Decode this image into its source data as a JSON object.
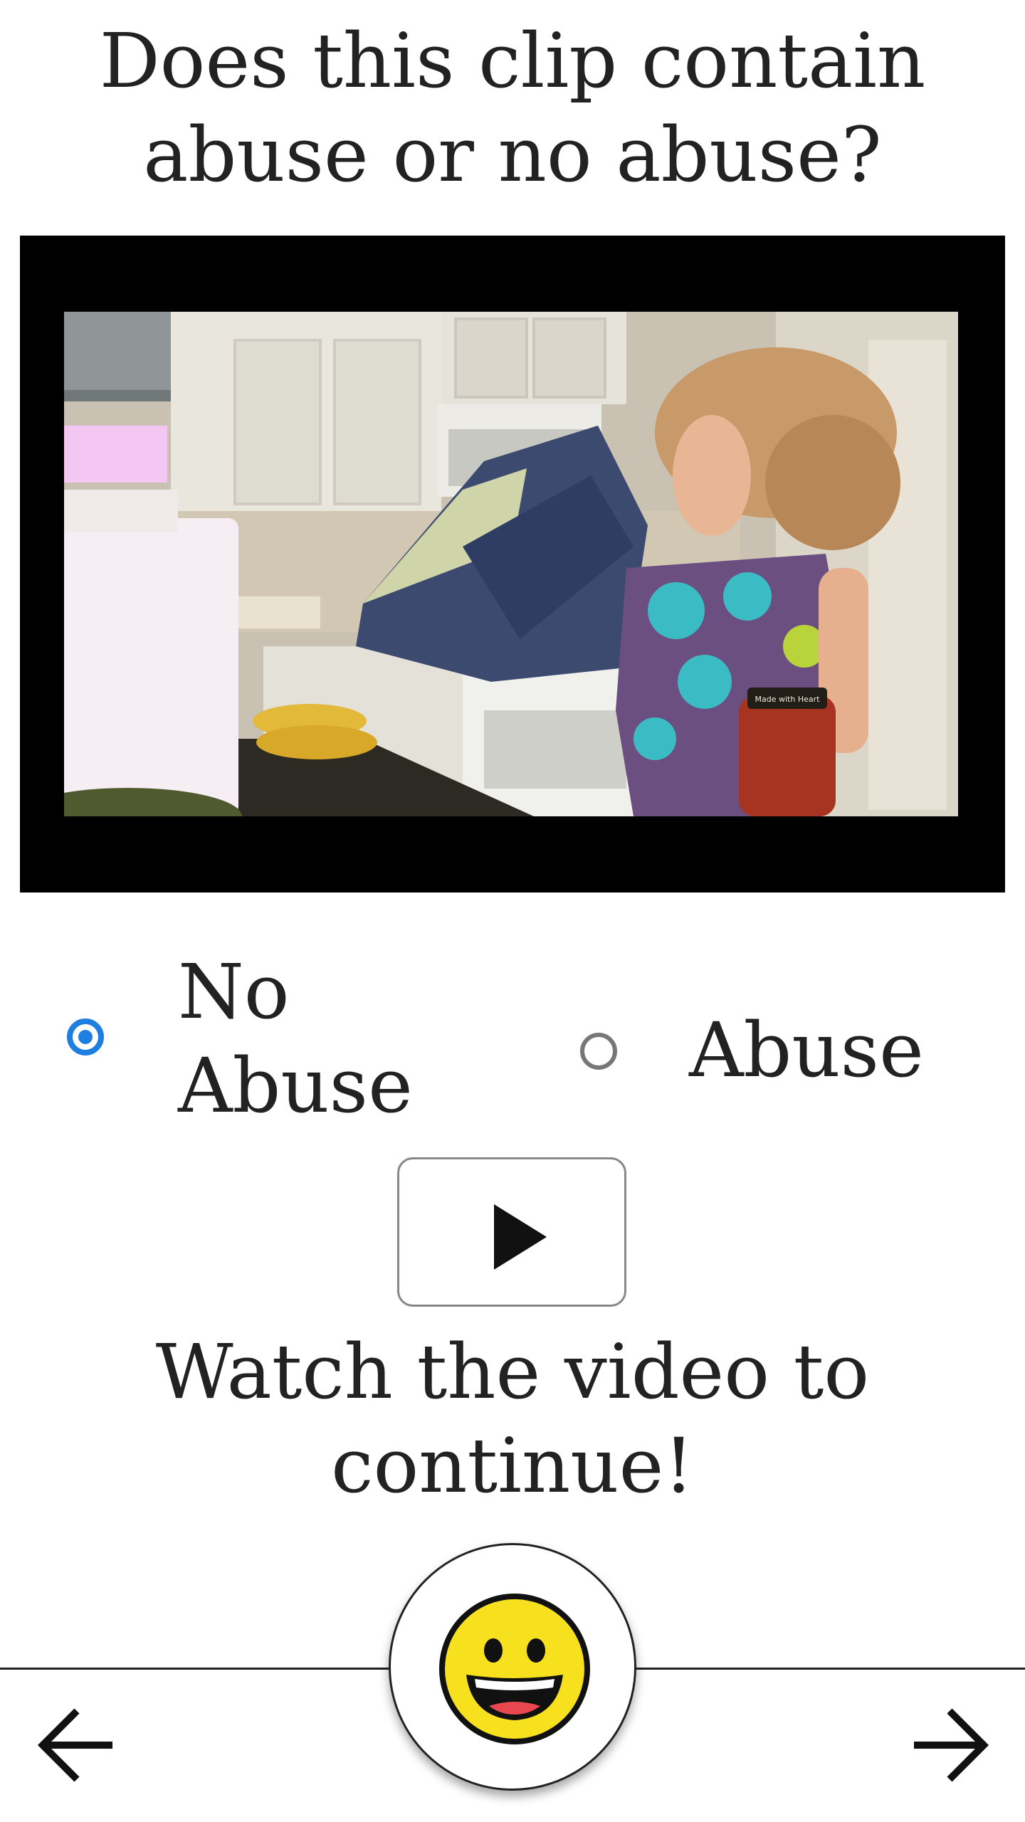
{
  "question": {
    "line1": "Does this clip contain",
    "line2": "abuse or no abuse?"
  },
  "video": {
    "jar_label": "Made with Heart"
  },
  "options": [
    {
      "line1": "No",
      "line2": "Abuse",
      "selected": true
    },
    {
      "line1": "Abuse",
      "selected": false
    }
  ],
  "play_icon": "play-icon",
  "watch_message": {
    "line1": "Watch the video to",
    "line2": "continue!"
  },
  "mascot_icon": "grinning-face-icon",
  "nav": {
    "back_icon": "arrow-left-icon",
    "forward_icon": "arrow-right-icon"
  },
  "colors": {
    "radio_selected": "#1e7fe0",
    "radio_unselected": "#777777",
    "emoji_face": "#f7e01e"
  }
}
